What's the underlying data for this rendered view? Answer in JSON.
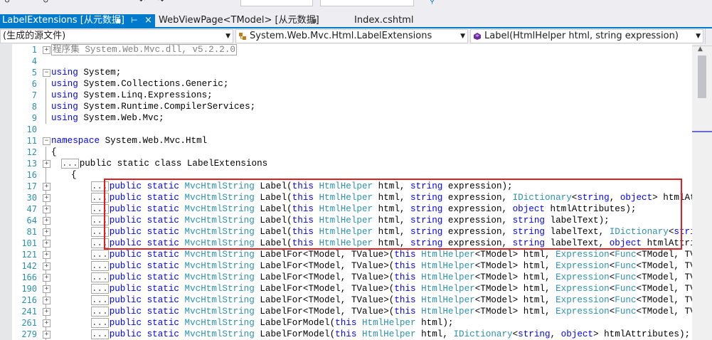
{
  "tabs": [
    {
      "label": "LabelExtensions [从元数据]",
      "pin": "⇔",
      "close": "×",
      "active": true
    },
    {
      "label": "WebViewPage<TModel> [从元数据]",
      "pin": "⊞",
      "active": false
    },
    {
      "label": "Index.cshtml",
      "active": false
    }
  ],
  "navbar": {
    "project": "(生成的源文件)",
    "type": "System.Web.Mvc.Html.LabelExtensions",
    "member": "Label(HtmlHelper html, string expression)",
    "arrow": "▼"
  },
  "colors": {
    "accent": "#007acc",
    "keyword": "#0000ff",
    "type": "#2b91af",
    "linenum": "#2b91af",
    "highlight": "#e02020"
  },
  "editor": {
    "line_numbers": [
      "1",
      "4",
      "5",
      "6",
      "7",
      "8",
      "9",
      "10",
      "11",
      "12",
      "13",
      "16",
      "17",
      "30",
      "47",
      "64",
      "81",
      "101",
      "121",
      "142",
      "166",
      "190",
      "216",
      "241",
      "261",
      "279"
    ],
    "assembly": "程序集 System.Web.Mvc.dll, v5.2.2.0",
    "using_1": "System;",
    "using_2": "System.Collections.Generic;",
    "using_3": "System.Linq.Expressions;",
    "using_4": "System.Runtime.CompilerServices;",
    "using_5": "System.Web.Mvc;",
    "namespace": "System.Web.Mvc.Html",
    "open_brace": "{",
    "class_decl": "public static class LabelExtensions",
    "ellipsis": "...",
    "methods": [
      "public static MvcHtmlString Label(this HtmlHelper html, string expression);",
      "public static MvcHtmlString Label(this HtmlHelper html, string expression, IDictionary<string, object> htmlAttributes);",
      "public static MvcHtmlString Label(this HtmlHelper html, string expression, object htmlAttributes);",
      "public static MvcHtmlString Label(this HtmlHelper html, string expression, string labelText);",
      "public static MvcHtmlString Label(this HtmlHelper html, string expression, string labelText, IDictionary<string, object",
      "public static MvcHtmlString Label(this HtmlHelper html, string expression, string labelText, object htmlAttributes);",
      "public static MvcHtmlString LabelFor<TModel, TValue>(this HtmlHelper<TModel> html, Expression<Func<TModel, TValue>> ex",
      "public static MvcHtmlString LabelFor<TModel, TValue>(this HtmlHelper<TModel> html, Expression<Func<TModel, TValue>> ex",
      "public static MvcHtmlString LabelFor<TModel, TValue>(this HtmlHelper<TModel> html, Expression<Func<TModel, TValue>> ex",
      "public static MvcHtmlString LabelFor<TModel, TValue>(this HtmlHelper<TModel> html, Expression<Func<TModel, TValue>> ex",
      "public static MvcHtmlString LabelFor<TModel, TValue>(this HtmlHelper<TModel> html, Expression<Func<TModel, TValue>> ex",
      "public static MvcHtmlString LabelFor<TModel, TValue>(this HtmlHelper<TModel> html, Expression<Func<TModel, TValue>> ex",
      "public static MvcHtmlString LabelForModel(this HtmlHelper html);",
      "public static MvcHtmlString LabelForModel(this HtmlHelper html, IDictionary<string, object> htmlAttributes);"
    ]
  },
  "scrollbar": {
    "arrow_up": "▲"
  }
}
